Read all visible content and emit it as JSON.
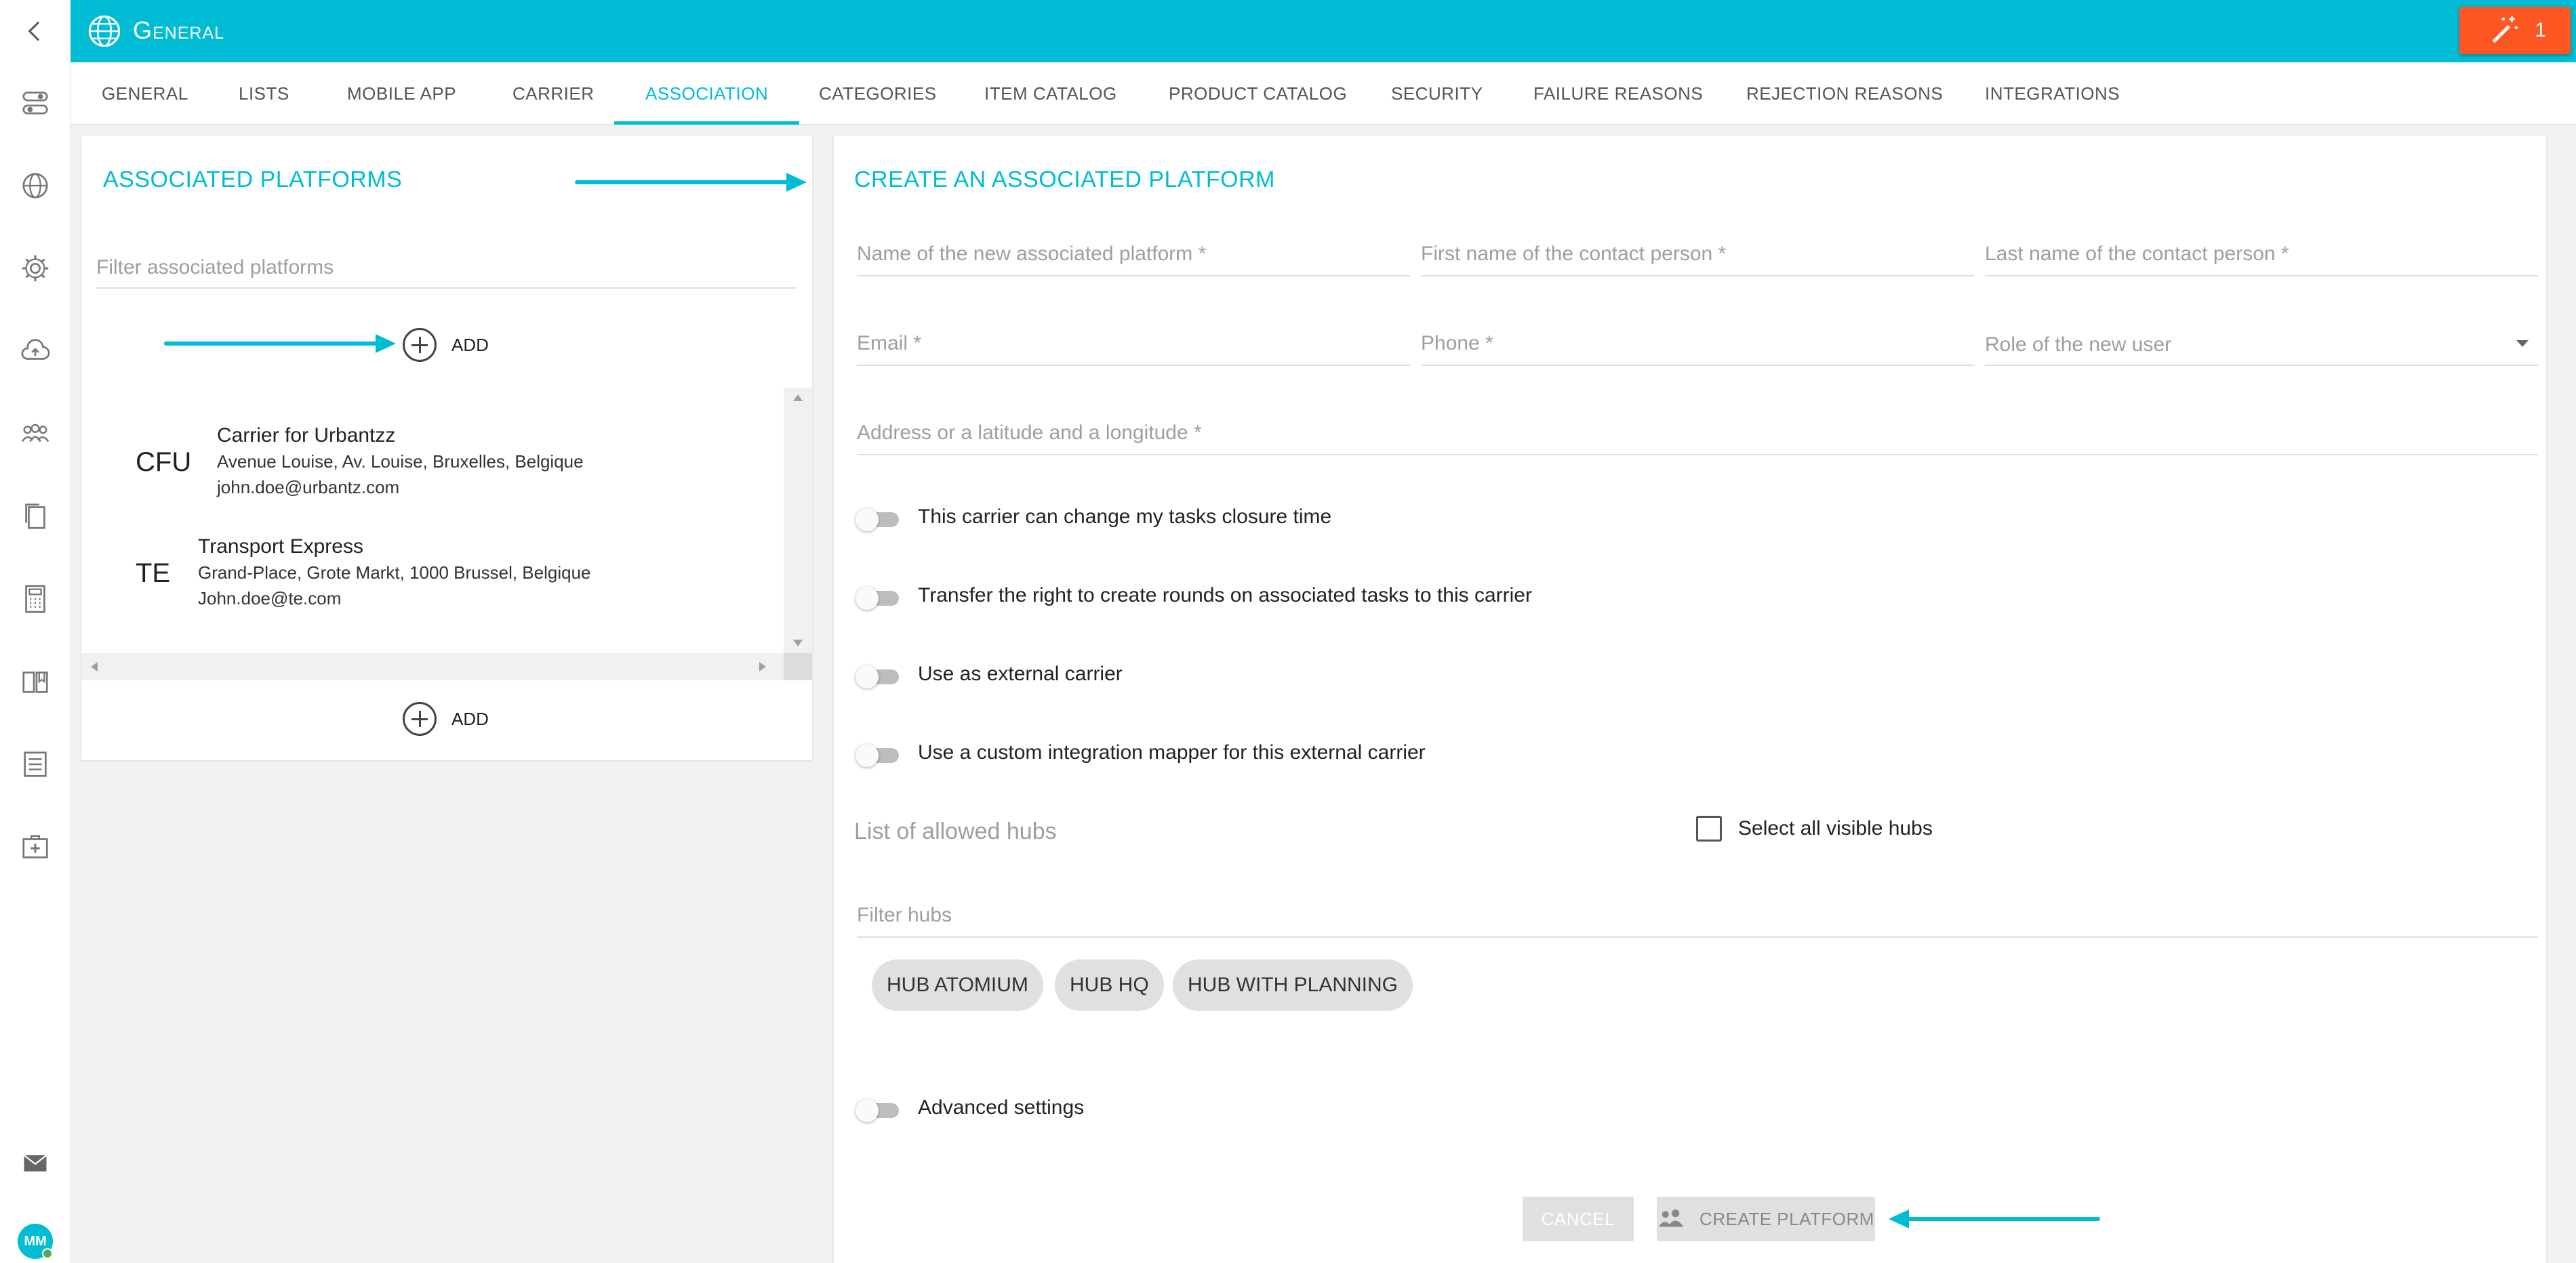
{
  "header": {
    "title": "General",
    "back_icon": "chevron-left-icon",
    "app_icon": "globe-icon",
    "notification": {
      "icon": "magic-wand-icon",
      "count": "1",
      "color": "#ff5722"
    }
  },
  "colors": {
    "accent": "#00bcd4",
    "notification": "#ff5722",
    "online": "#4caf50"
  },
  "sidebar": {
    "items": [
      {
        "icon": "toggle-icon",
        "name": "settings-toggle"
      },
      {
        "icon": "globe-icon",
        "name": "general"
      },
      {
        "icon": "gear-icon",
        "name": "settings"
      },
      {
        "icon": "cloud-upload-icon",
        "name": "upload"
      },
      {
        "icon": "team-icon",
        "name": "team"
      },
      {
        "icon": "document-copy-icon",
        "name": "documents"
      },
      {
        "icon": "calculator-icon",
        "name": "calculator"
      },
      {
        "icon": "book-icon",
        "name": "catalog"
      },
      {
        "icon": "list-icon",
        "name": "list"
      },
      {
        "icon": "first-aid-kit-icon",
        "name": "first-aid"
      }
    ],
    "mail_icon": "mail-icon",
    "avatar_initials": "MM"
  },
  "tabs": [
    {
      "label": "GENERAL"
    },
    {
      "label": "LISTS"
    },
    {
      "label": "MOBILE APP"
    },
    {
      "label": "CARRIER"
    },
    {
      "label": "ASSOCIATION",
      "active": true
    },
    {
      "label": "CATEGORIES"
    },
    {
      "label": "ITEM CATALOG"
    },
    {
      "label": "PRODUCT CATALOG"
    },
    {
      "label": "SECURITY"
    },
    {
      "label": "FAILURE REASONS"
    },
    {
      "label": "REJECTION REASONS"
    },
    {
      "label": "INTEGRATIONS"
    }
  ],
  "left_panel": {
    "title": "ASSOCIATED PLATFORMS",
    "filter_placeholder": "Filter associated platforms",
    "add_label": "ADD",
    "platforms": [
      {
        "abbr": "CFU",
        "name": "Carrier for Urbantzz",
        "address": "Avenue Louise, Av. Louise, Bruxelles, Belgique",
        "email": "john.doe@urbantz.com"
      },
      {
        "abbr": "TE",
        "name": "Transport Express",
        "address": "Grand-Place, Grote Markt, 1000 Brussel, Belgique",
        "email": "John.doe@te.com"
      }
    ]
  },
  "right_panel": {
    "title": "CREATE AN ASSOCIATED PLATFORM",
    "fields": {
      "platform_name": "Name of the new associated platform *",
      "first_name": "First name of the contact person *",
      "last_name": "Last name of the contact person *",
      "email": "Email *",
      "phone": "Phone *",
      "role": "Role of the new user",
      "address": "Address or a latitude and a longitude *"
    },
    "toggles": [
      {
        "label": "This carrier can change my tasks closure time",
        "on": false
      },
      {
        "label": "Transfer the right to create rounds on associated tasks to this carrier",
        "on": false
      },
      {
        "label": "Use as external carrier",
        "on": false
      },
      {
        "label": "Use a custom integration mapper for this external carrier",
        "on": false
      }
    ],
    "hubs_label": "List of allowed hubs",
    "select_all_label": "Select all visible hubs",
    "filter_hubs_placeholder": "Filter hubs",
    "hubs": [
      "HUB ATOMIUM",
      "HUB HQ",
      "HUB WITH PLANNING"
    ],
    "advanced_label": "Advanced settings",
    "cancel_label": "CANCEL",
    "create_label": "CREATE PLATFORM",
    "create_icon": "team-icon"
  }
}
